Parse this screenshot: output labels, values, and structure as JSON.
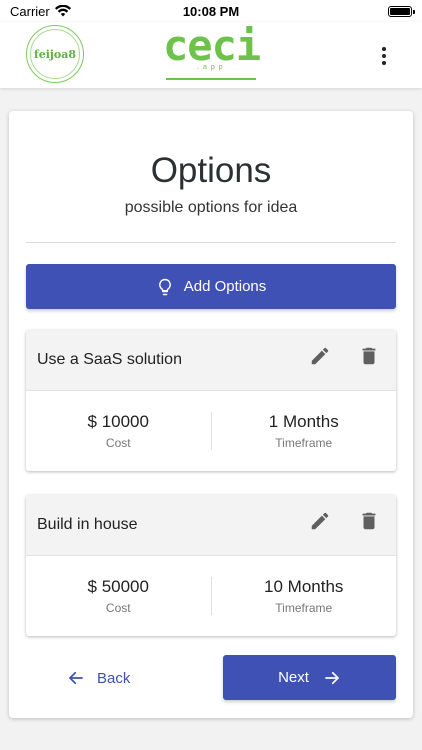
{
  "status_bar": {
    "carrier": "Carrier",
    "time": "10:08 PM",
    "signal_icon": "wifi-icon",
    "battery_icon": "battery-icon"
  },
  "header": {
    "left_logo_text": "feijoa8",
    "center_logo_text": "ceci",
    "center_logo_sub": ".app",
    "menu_icon": "more-vertical-icon",
    "brand_color": "#6dc24b"
  },
  "page": {
    "title": "Options",
    "subtitle": "possible options for idea"
  },
  "add_button": {
    "label": "Add Options",
    "icon": "lightbulb-icon",
    "color": "#3f51b5"
  },
  "options": [
    {
      "name": "Use a SaaS solution",
      "cost": "$ 10000",
      "cost_label": "Cost",
      "timeframe": "1 Months",
      "timeframe_label": "Timeframe"
    },
    {
      "name": "Build in house",
      "cost": "$ 50000",
      "cost_label": "Cost",
      "timeframe": "10 Months",
      "timeframe_label": "Timeframe"
    }
  ],
  "nav": {
    "back_label": "Back",
    "next_label": "Next"
  }
}
